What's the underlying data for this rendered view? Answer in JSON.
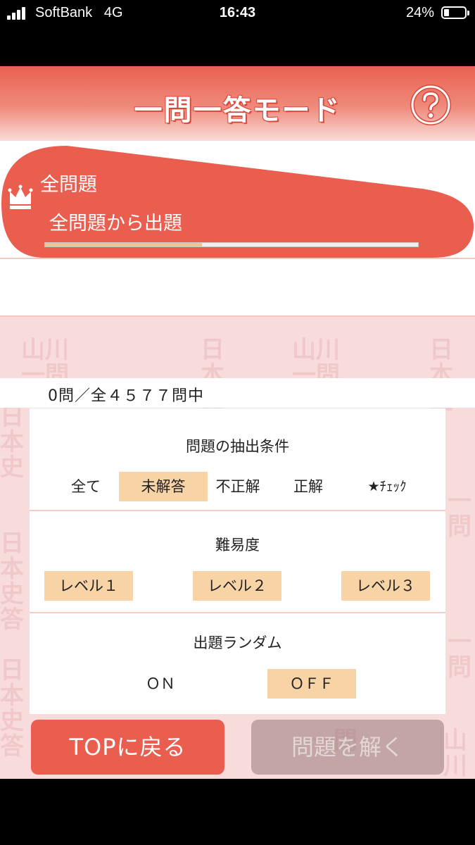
{
  "status_bar": {
    "carrier": "SoftBank",
    "network": "4G",
    "time": "16:43",
    "battery_percent": "24%",
    "battery_level": 0.24,
    "icons": [
      "signal-icon",
      "battery-icon"
    ]
  },
  "header": {
    "title": "一問一答モード",
    "help_icon": "question-circle-icon"
  },
  "category": {
    "icon": "crown-icon",
    "title": "全問題",
    "subtitle": "全問題から出題",
    "progress": 0.42,
    "color": "#ea5e4f"
  },
  "watermark": {
    "mark_a": "山川",
    "mark_b": "一問",
    "mark_c": "日本史",
    "mark_d": "答"
  },
  "question_count": "0問／全４５７７問中",
  "filters": {
    "extract": {
      "title": "問題の抽出条件",
      "options": [
        "全て",
        "未解答",
        "不正解",
        "正解",
        "★ﾁｪｯｸ"
      ],
      "selected": "未解答"
    },
    "difficulty": {
      "title": "難易度",
      "options": [
        "レベル１",
        "レベル２",
        "レベル３"
      ],
      "selected": [
        "レベル１",
        "レベル２",
        "レベル３"
      ]
    },
    "random": {
      "title": "出題ランダム",
      "options": [
        "ＯＮ",
        "ＯＦＦ"
      ],
      "selected": "ＯＦＦ"
    }
  },
  "buttons": {
    "top": "TOPに戻る",
    "solve": "問題を解く"
  },
  "colors": {
    "accent": "#ea5e4f",
    "selected_option": "#f8d3a6",
    "background_pink": "#f8dcdc"
  }
}
